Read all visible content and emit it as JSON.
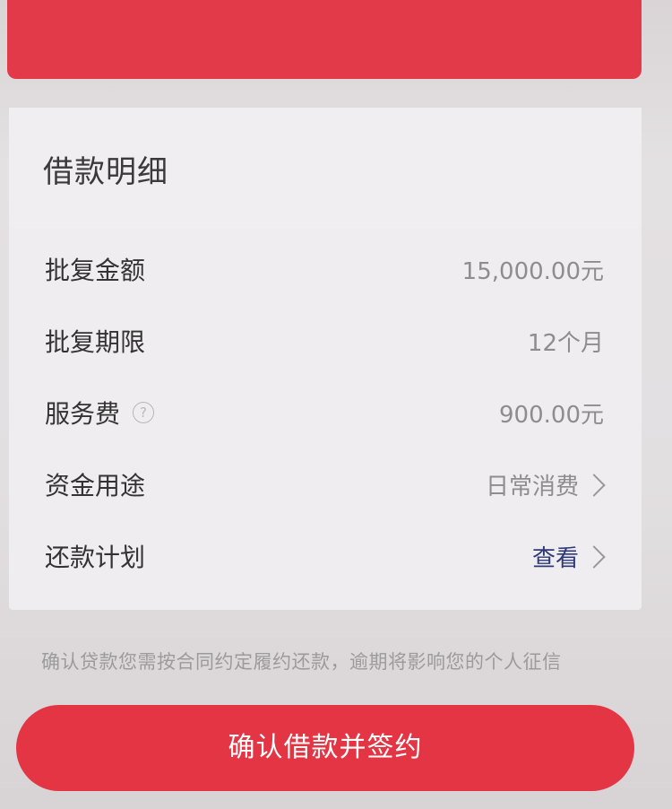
{
  "loan_detail": {
    "title": "借款明细",
    "rows": [
      {
        "label": "批复金额",
        "value": "15,000.00元"
      },
      {
        "label": "批复期限",
        "value": "12个月"
      },
      {
        "label": "服务费",
        "value": "900.00元",
        "help_icon": "help-circle-icon"
      },
      {
        "label": "资金用途",
        "value": "日常消费",
        "arrow_icon": "chevron-right-icon"
      },
      {
        "label": "还款计划",
        "value": "查看",
        "arrow_icon": "chevron-right-icon"
      }
    ]
  },
  "notice": "确认贷款您需按合同约定履约还款，逾期将影响您的个人征信",
  "confirm_button": {
    "label": "确认借款并签约"
  },
  "colors": {
    "accent_red": "#e23a48",
    "link_blue": "#2e3a78",
    "muted_text": "#8e8c8d"
  }
}
